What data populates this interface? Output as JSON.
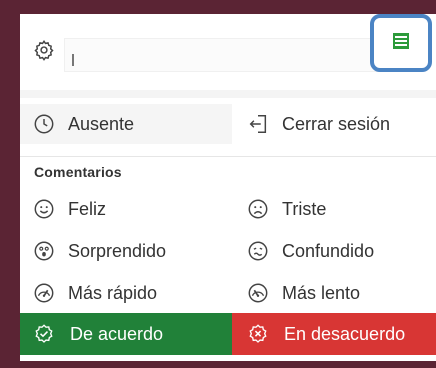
{
  "status": {
    "value": "",
    "icons": {
      "settings": "gear-icon",
      "menu": "hamburger-menu-icon"
    }
  },
  "actions": {
    "away": {
      "label": "Ausente",
      "icon": "clock-icon"
    },
    "logout": {
      "label": "Cerrar sesión",
      "icon": "logout-icon"
    }
  },
  "feedback": {
    "section_title": "Comentarios",
    "items": [
      {
        "label": "Feliz",
        "icon": "happy-face-icon"
      },
      {
        "label": "Triste",
        "icon": "sad-face-icon"
      },
      {
        "label": "Sorprendido",
        "icon": "surprised-face-icon"
      },
      {
        "label": "Confundido",
        "icon": "confused-face-icon"
      },
      {
        "label": "Más rápido",
        "icon": "faster-speed-icon"
      },
      {
        "label": "Más lento",
        "icon": "slower-speed-icon"
      }
    ]
  },
  "bottom": {
    "agree": {
      "label": "De acuerdo",
      "icon": "check-badge-icon",
      "color": "#218139"
    },
    "disagree": {
      "label": "En desacuerdo",
      "icon": "x-badge-icon",
      "color": "#d83634"
    }
  },
  "colors": {
    "background": "#5b2434",
    "highlight_border": "#4b84c4",
    "menu_icon": "#2c9a3a"
  }
}
